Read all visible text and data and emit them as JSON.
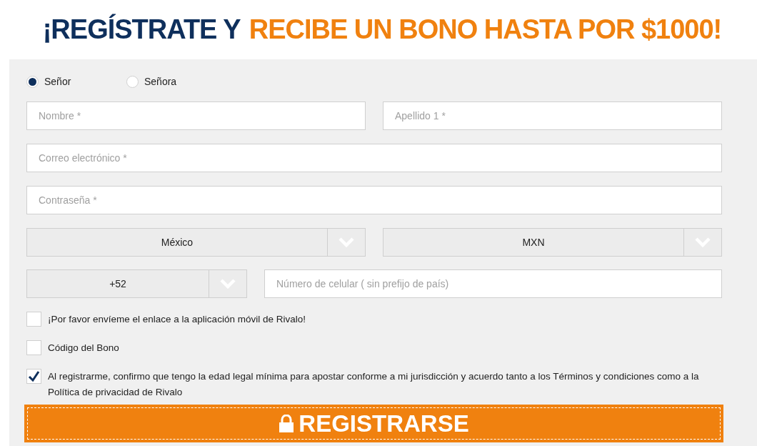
{
  "headline": {
    "lead": "¡REGÍSTRATE Y",
    "highlight": "RECIBE UN BONO HASTA POR $1000!"
  },
  "gender": [
    {
      "label": "Señor",
      "selected": true
    },
    {
      "label": "Señora",
      "selected": false
    }
  ],
  "name_fields": [
    {
      "placeholder": "Nombre *"
    },
    {
      "placeholder": "Apellido 1 *"
    }
  ],
  "email": {
    "placeholder": "Correo electrónico *"
  },
  "password": {
    "placeholder": "Contraseña *"
  },
  "country": {
    "value": "México"
  },
  "currency": {
    "value": "MXN"
  },
  "phone_prefix": {
    "value": "+52"
  },
  "phone": {
    "placeholder": "Número de celular ( sin prefijo de país)"
  },
  "checkboxes": [
    {
      "label": "¡Por favor envíeme el enlace a la aplicación móvil de Rivalo!",
      "checked": false
    },
    {
      "label": "Código del Bono",
      "checked": false
    },
    {
      "label": "Al registrarme, confirmo que tengo la edad legal mínima para apostar conforme a mi jurisdicción y acuerdo tanto a los Términos y condiciones como a la Política de privacidad de Rivalo",
      "checked": true
    }
  ],
  "submit": {
    "label": "REGISTRARSE"
  }
}
